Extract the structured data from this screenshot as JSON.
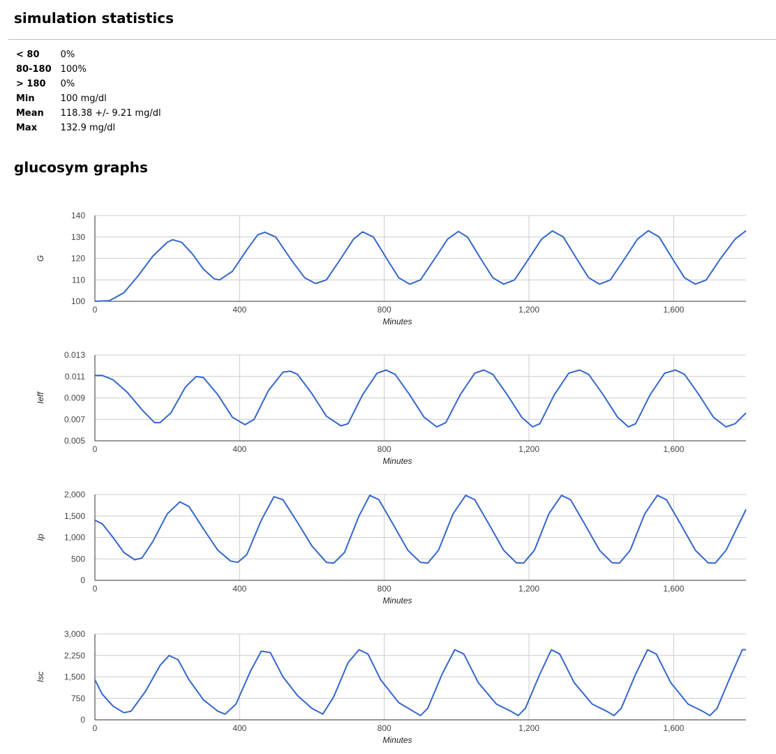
{
  "stats": {
    "title": "simulation statistics",
    "rows": [
      {
        "label": "< 80",
        "value": "0%"
      },
      {
        "label": "80-180",
        "value": "100%"
      },
      {
        "label": "> 180",
        "value": "0%"
      },
      {
        "label": "Min",
        "value": "100 mg/dl"
      },
      {
        "label": "Mean",
        "value": "118.38 +/- 9.21 mg/dl"
      },
      {
        "label": "Max",
        "value": "132.9 mg/dl"
      }
    ]
  },
  "graphs": {
    "title": "glucosym graphs"
  },
  "colors": {
    "line": "#3366cc",
    "grid": "#cccccc",
    "axis": "#333333",
    "label": "#444444"
  },
  "chart_data": [
    {
      "type": "line",
      "ylabel": "G",
      "xlabel": "Minutes",
      "xlim": [
        0,
        1800
      ],
      "ylim": [
        100,
        140
      ],
      "xticks": [
        0,
        400,
        800,
        1200,
        1600
      ],
      "xtick_labels": [
        "0",
        "400",
        "800",
        "1,200",
        "1,600"
      ],
      "yticks": [
        100,
        110,
        120,
        130,
        140
      ],
      "ytick_labels": [
        "100",
        "110",
        "120",
        "130",
        "140"
      ],
      "grid": true,
      "points": [
        [
          0,
          100
        ],
        [
          40,
          100.3
        ],
        [
          80,
          104
        ],
        [
          120,
          112
        ],
        [
          160,
          121
        ],
        [
          200,
          127.5
        ],
        [
          215,
          128.7
        ],
        [
          240,
          127.5
        ],
        [
          270,
          122
        ],
        [
          300,
          115
        ],
        [
          330,
          110.5
        ],
        [
          345,
          110
        ],
        [
          380,
          114
        ],
        [
          420,
          124
        ],
        [
          450,
          131
        ],
        [
          470,
          132.2
        ],
        [
          500,
          130
        ],
        [
          540,
          120
        ],
        [
          580,
          111
        ],
        [
          610,
          108.3
        ],
        [
          640,
          110
        ],
        [
          680,
          120
        ],
        [
          715,
          129
        ],
        [
          740,
          132.4
        ],
        [
          770,
          130
        ],
        [
          810,
          119
        ],
        [
          840,
          111
        ],
        [
          870,
          108
        ],
        [
          900,
          110
        ],
        [
          940,
          120
        ],
        [
          975,
          129
        ],
        [
          1005,
          132.6
        ],
        [
          1030,
          130
        ],
        [
          1070,
          119
        ],
        [
          1100,
          111
        ],
        [
          1130,
          108
        ],
        [
          1160,
          110
        ],
        [
          1200,
          120
        ],
        [
          1235,
          129
        ],
        [
          1265,
          132.8
        ],
        [
          1295,
          130
        ],
        [
          1335,
          119
        ],
        [
          1365,
          111
        ],
        [
          1395,
          108
        ],
        [
          1425,
          110
        ],
        [
          1465,
          120
        ],
        [
          1500,
          129
        ],
        [
          1530,
          132.9
        ],
        [
          1560,
          130
        ],
        [
          1600,
          119
        ],
        [
          1630,
          111
        ],
        [
          1660,
          108
        ],
        [
          1690,
          110
        ],
        [
          1730,
          120
        ],
        [
          1770,
          129
        ],
        [
          1800,
          132.9
        ]
      ]
    },
    {
      "type": "line",
      "ylabel": "Ieff",
      "xlabel": "Minutes",
      "xlim": [
        0,
        1800
      ],
      "ylim": [
        0.005,
        0.013
      ],
      "xticks": [
        0,
        400,
        800,
        1200,
        1600
      ],
      "xtick_labels": [
        "0",
        "400",
        "800",
        "1,200",
        "1,600"
      ],
      "yticks": [
        0.005,
        0.007,
        0.009,
        0.011,
        0.013
      ],
      "ytick_labels": [
        "0.005",
        "0.007",
        "0.009",
        "0.011",
        "0.013"
      ],
      "grid": true,
      "points": [
        [
          0,
          0.0111
        ],
        [
          20,
          0.0111
        ],
        [
          50,
          0.0107
        ],
        [
          90,
          0.0095
        ],
        [
          130,
          0.0079
        ],
        [
          165,
          0.0067
        ],
        [
          180,
          0.0067
        ],
        [
          210,
          0.0076
        ],
        [
          250,
          0.01
        ],
        [
          280,
          0.011
        ],
        [
          300,
          0.0109
        ],
        [
          340,
          0.0093
        ],
        [
          380,
          0.0072
        ],
        [
          415,
          0.0065
        ],
        [
          440,
          0.007
        ],
        [
          480,
          0.0097
        ],
        [
          520,
          0.0114
        ],
        [
          540,
          0.0115
        ],
        [
          560,
          0.0112
        ],
        [
          600,
          0.0094
        ],
        [
          640,
          0.0073
        ],
        [
          680,
          0.0064
        ],
        [
          700,
          0.0066
        ],
        [
          740,
          0.0093
        ],
        [
          780,
          0.0113
        ],
        [
          805,
          0.0116
        ],
        [
          830,
          0.0112
        ],
        [
          870,
          0.0093
        ],
        [
          910,
          0.0072
        ],
        [
          945,
          0.0063
        ],
        [
          970,
          0.0067
        ],
        [
          1010,
          0.0093
        ],
        [
          1050,
          0.0113
        ],
        [
          1075,
          0.0116
        ],
        [
          1100,
          0.0112
        ],
        [
          1140,
          0.0093
        ],
        [
          1180,
          0.0072
        ],
        [
          1210,
          0.0063
        ],
        [
          1230,
          0.0066
        ],
        [
          1270,
          0.0093
        ],
        [
          1310,
          0.0113
        ],
        [
          1340,
          0.0116
        ],
        [
          1365,
          0.0112
        ],
        [
          1405,
          0.0093
        ],
        [
          1445,
          0.0072
        ],
        [
          1475,
          0.0063
        ],
        [
          1495,
          0.0066
        ],
        [
          1535,
          0.0093
        ],
        [
          1575,
          0.0113
        ],
        [
          1605,
          0.0116
        ],
        [
          1630,
          0.0112
        ],
        [
          1670,
          0.0093
        ],
        [
          1710,
          0.0072
        ],
        [
          1745,
          0.0063
        ],
        [
          1770,
          0.0066
        ],
        [
          1800,
          0.0076
        ]
      ]
    },
    {
      "type": "line",
      "ylabel": "Ip",
      "xlabel": "Minutes",
      "xlim": [
        0,
        1800
      ],
      "ylim": [
        0,
        2000
      ],
      "xticks": [
        0,
        400,
        800,
        1200,
        1600
      ],
      "xtick_labels": [
        "0",
        "400",
        "800",
        "1,200",
        "1,600"
      ],
      "yticks": [
        0,
        500,
        1000,
        1500,
        2000
      ],
      "ytick_labels": [
        "0",
        "500",
        "1,000",
        "1,500",
        "2,000"
      ],
      "grid": true,
      "points": [
        [
          0,
          1400
        ],
        [
          20,
          1320
        ],
        [
          50,
          1000
        ],
        [
          80,
          650
        ],
        [
          110,
          480
        ],
        [
          130,
          520
        ],
        [
          160,
          900
        ],
        [
          200,
          1550
        ],
        [
          235,
          1830
        ],
        [
          260,
          1720
        ],
        [
          300,
          1200
        ],
        [
          340,
          700
        ],
        [
          375,
          450
        ],
        [
          395,
          420
        ],
        [
          420,
          600
        ],
        [
          460,
          1400
        ],
        [
          495,
          1950
        ],
        [
          520,
          1880
        ],
        [
          560,
          1350
        ],
        [
          600,
          800
        ],
        [
          640,
          420
        ],
        [
          660,
          400
        ],
        [
          690,
          650
        ],
        [
          730,
          1500
        ],
        [
          760,
          1980
        ],
        [
          785,
          1880
        ],
        [
          825,
          1300
        ],
        [
          865,
          700
        ],
        [
          900,
          420
        ],
        [
          920,
          400
        ],
        [
          950,
          700
        ],
        [
          990,
          1550
        ],
        [
          1025,
          1980
        ],
        [
          1050,
          1880
        ],
        [
          1090,
          1300
        ],
        [
          1130,
          700
        ],
        [
          1165,
          410
        ],
        [
          1185,
          400
        ],
        [
          1215,
          700
        ],
        [
          1255,
          1550
        ],
        [
          1290,
          1980
        ],
        [
          1315,
          1880
        ],
        [
          1355,
          1300
        ],
        [
          1395,
          700
        ],
        [
          1430,
          410
        ],
        [
          1450,
          400
        ],
        [
          1480,
          700
        ],
        [
          1520,
          1550
        ],
        [
          1555,
          1980
        ],
        [
          1580,
          1880
        ],
        [
          1620,
          1300
        ],
        [
          1660,
          700
        ],
        [
          1695,
          410
        ],
        [
          1715,
          400
        ],
        [
          1745,
          700
        ],
        [
          1800,
          1650
        ]
      ]
    },
    {
      "type": "line",
      "ylabel": "Isc",
      "xlabel": "Minutes",
      "xlim": [
        0,
        1800
      ],
      "ylim": [
        0,
        3000
      ],
      "xticks": [
        0,
        400,
        800,
        1200,
        1600
      ],
      "xtick_labels": [
        "0",
        "400",
        "800",
        "1,200",
        "1,600"
      ],
      "yticks": [
        0,
        750,
        1500,
        2250,
        3000
      ],
      "ytick_labels": [
        "0",
        "750",
        "1,500",
        "2,250",
        "3,000"
      ],
      "grid": true,
      "points": [
        [
          0,
          1400
        ],
        [
          20,
          900
        ],
        [
          50,
          480
        ],
        [
          80,
          250
        ],
        [
          100,
          300
        ],
        [
          140,
          1000
        ],
        [
          180,
          1900
        ],
        [
          205,
          2250
        ],
        [
          230,
          2100
        ],
        [
          260,
          1400
        ],
        [
          300,
          700
        ],
        [
          340,
          300
        ],
        [
          360,
          200
        ],
        [
          390,
          550
        ],
        [
          430,
          1700
        ],
        [
          460,
          2400
        ],
        [
          485,
          2350
        ],
        [
          520,
          1500
        ],
        [
          560,
          850
        ],
        [
          600,
          400
        ],
        [
          630,
          200
        ],
        [
          660,
          800
        ],
        [
          700,
          2000
        ],
        [
          730,
          2450
        ],
        [
          755,
          2300
        ],
        [
          790,
          1400
        ],
        [
          840,
          600
        ],
        [
          880,
          300
        ],
        [
          900,
          150
        ],
        [
          920,
          400
        ],
        [
          960,
          1600
        ],
        [
          995,
          2450
        ],
        [
          1020,
          2300
        ],
        [
          1060,
          1300
        ],
        [
          1110,
          550
        ],
        [
          1150,
          300
        ],
        [
          1170,
          150
        ],
        [
          1190,
          400
        ],
        [
          1230,
          1600
        ],
        [
          1262,
          2450
        ],
        [
          1285,
          2300
        ],
        [
          1325,
          1300
        ],
        [
          1375,
          550
        ],
        [
          1415,
          300
        ],
        [
          1435,
          150
        ],
        [
          1455,
          400
        ],
        [
          1495,
          1600
        ],
        [
          1528,
          2450
        ],
        [
          1552,
          2300
        ],
        [
          1592,
          1300
        ],
        [
          1640,
          550
        ],
        [
          1680,
          300
        ],
        [
          1700,
          150
        ],
        [
          1720,
          400
        ],
        [
          1760,
          1600
        ],
        [
          1790,
          2450
        ],
        [
          1800,
          2450
        ]
      ]
    }
  ]
}
